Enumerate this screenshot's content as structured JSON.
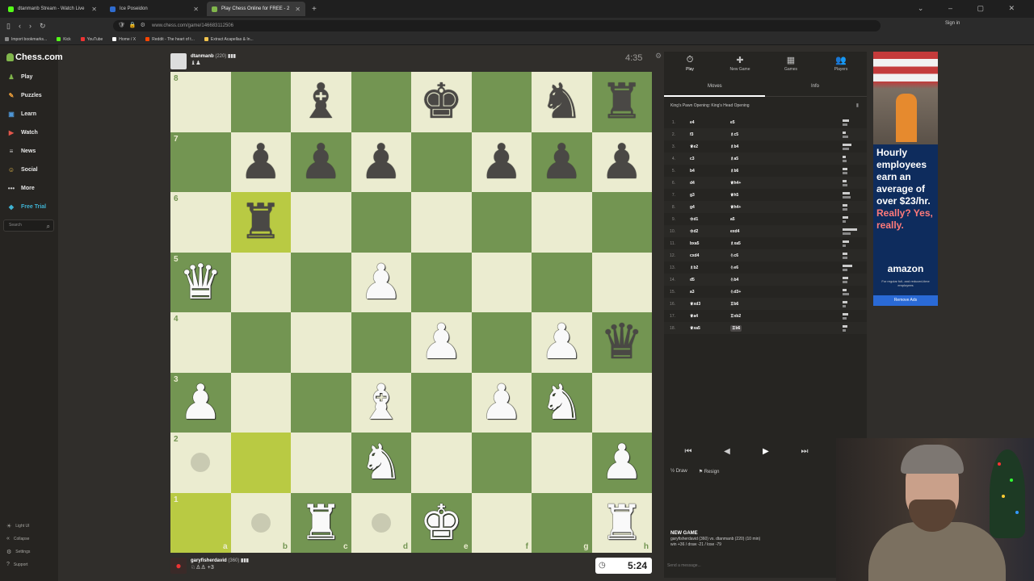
{
  "browser": {
    "tabs": [
      {
        "label": "dtanmanb Stream - Watch Live",
        "active": false
      },
      {
        "label": "Ice Poseidon",
        "active": false
      },
      {
        "label": "Play Chess Online for FREE - 2",
        "active": true
      }
    ],
    "url": "www.chess.com/game/146683112506",
    "sign_in": "Sign in",
    "bookmarks": [
      "Import bookmarks...",
      "Kick",
      "YouTube",
      "Home / X",
      "Reddit - The heart of t...",
      "Extract Acapellas & In..."
    ]
  },
  "sidebar": {
    "logo": "Chess.com",
    "items": [
      {
        "label": "Play",
        "icon": "♟",
        "color": "#81b64c"
      },
      {
        "label": "Puzzles",
        "icon": "✎",
        "color": "#f0a13a"
      },
      {
        "label": "Learn",
        "icon": "▣",
        "color": "#4e96d6"
      },
      {
        "label": "Watch",
        "icon": "▶",
        "color": "#e3564b"
      },
      {
        "label": "News",
        "icon": "≡",
        "color": "#c8c8c8"
      },
      {
        "label": "Social",
        "icon": "☺",
        "color": "#f1c34d"
      },
      {
        "label": "More",
        "icon": "•••",
        "color": "#c8c8c8"
      },
      {
        "label": "Free Trial",
        "icon": "◆",
        "color": "#3fb3d3"
      }
    ],
    "search_placeholder": "Search",
    "bottom": [
      {
        "label": "Light UI",
        "icon": "☀"
      },
      {
        "label": "Collapse",
        "icon": "«"
      },
      {
        "label": "Settings",
        "icon": "⚙"
      },
      {
        "label": "Support",
        "icon": "?"
      }
    ]
  },
  "top_player": {
    "name": "dtanmanb",
    "rating": "(220)",
    "captured": "♝♟",
    "clock": "4:35"
  },
  "bottom_player": {
    "name": "garyfisherdavid",
    "rating": "(360)",
    "captured": "♘♙♙ +3",
    "clock": "5:24"
  },
  "board": {
    "files": [
      "a",
      "b",
      "c",
      "d",
      "e",
      "f",
      "g",
      "h"
    ],
    "ranks": [
      "8",
      "7",
      "6",
      "5",
      "4",
      "3",
      "2",
      "1"
    ],
    "highlights": [
      "b6",
      "b2",
      "a1"
    ],
    "hints": [
      "a2",
      "b1",
      "d1"
    ],
    "pieces": [
      {
        "sq": "c8",
        "p": "b"
      },
      {
        "sq": "e8",
        "p": "k"
      },
      {
        "sq": "g8",
        "p": "n"
      },
      {
        "sq": "h8",
        "p": "r"
      },
      {
        "sq": "b7",
        "p": "p"
      },
      {
        "sq": "c7",
        "p": "p"
      },
      {
        "sq": "d7",
        "p": "p"
      },
      {
        "sq": "f7",
        "p": "p"
      },
      {
        "sq": "g7",
        "p": "p"
      },
      {
        "sq": "h7",
        "p": "p"
      },
      {
        "sq": "b6",
        "p": "r"
      },
      {
        "sq": "a5",
        "p": "Q"
      },
      {
        "sq": "d5",
        "p": "P"
      },
      {
        "sq": "e4",
        "p": "P"
      },
      {
        "sq": "g4",
        "p": "P"
      },
      {
        "sq": "h4",
        "p": "q"
      },
      {
        "sq": "a3",
        "p": "P"
      },
      {
        "sq": "d3",
        "p": "B"
      },
      {
        "sq": "f3",
        "p": "P"
      },
      {
        "sq": "g3",
        "p": "N"
      },
      {
        "sq": "d2",
        "p": "N"
      },
      {
        "sq": "h2",
        "p": "P"
      },
      {
        "sq": "c1",
        "p": "R"
      },
      {
        "sq": "e1",
        "p": "K"
      },
      {
        "sq": "h1",
        "p": "R"
      }
    ]
  },
  "panel": {
    "tabs": [
      {
        "label": "Play",
        "icon": "⏱"
      },
      {
        "label": "New Game",
        "icon": "✚"
      },
      {
        "label": "Games",
        "icon": "▦"
      },
      {
        "label": "Players",
        "icon": "👥"
      }
    ],
    "subtabs": [
      "Moves",
      "Info"
    ],
    "opening": "King's Pawn Opening: King's Head Opening",
    "moves": [
      {
        "n": "1.",
        "w": "e4",
        "b": "e5",
        "tw": 0.4,
        "tb": 0.3
      },
      {
        "n": "2.",
        "w": "f3",
        "b": "♗c5",
        "tw": 0.2,
        "tb": 0.35
      },
      {
        "n": "3.",
        "w": "♕e2",
        "b": "♗b4",
        "tw": 0.55,
        "tb": 0.4
      },
      {
        "n": "4.",
        "w": "c3",
        "b": "♗a5",
        "tw": 0.2,
        "tb": 0.25
      },
      {
        "n": "5.",
        "w": "b4",
        "b": "♗b6",
        "tw": 0.3,
        "tb": 0.3
      },
      {
        "n": "6.",
        "w": "d4",
        "b": "♕h4+",
        "tw": 0.25,
        "tb": 0.3
      },
      {
        "n": "7.",
        "w": "g3",
        "b": "♕h5",
        "tw": 0.45,
        "tb": 0.5
      },
      {
        "n": "8.",
        "w": "g4",
        "b": "♕h4+",
        "tw": 0.3,
        "tb": 0.3
      },
      {
        "n": "9.",
        "w": "♔d1",
        "b": "a5",
        "tw": 0.35,
        "tb": 0.2
      },
      {
        "n": "10.",
        "w": "♔d2",
        "b": "exd4",
        "tw": 0.9,
        "tb": 0.5
      },
      {
        "n": "11.",
        "w": "bxa5",
        "b": "♗xa5",
        "tw": 0.4,
        "tb": 0.2
      },
      {
        "n": "12.",
        "w": "cxd4",
        "b": "♘c6",
        "tw": 0.3,
        "tb": 0.3
      },
      {
        "n": "13.",
        "w": "♗b2",
        "b": "♘e6",
        "tw": 0.6,
        "tb": 0.3
      },
      {
        "n": "14.",
        "w": "d5",
        "b": "♘b4",
        "tw": 0.35,
        "tb": 0.3
      },
      {
        "n": "15.",
        "w": "a3",
        "b": "♘d3+",
        "tw": 0.25,
        "tb": 0.4
      },
      {
        "n": "16.",
        "w": "♕xd3",
        "b": "♖b6",
        "tw": 0.3,
        "tb": 0.2
      },
      {
        "n": "17.",
        "w": "♕a4",
        "b": "♖xb2",
        "tw": 0.35,
        "tb": 0.25
      },
      {
        "n": "18.",
        "w": "♕xa5",
        "b": "♖b6",
        "tw": 0.3,
        "tb": 0.2
      }
    ],
    "controls": [
      "⏮",
      "◀",
      "▶",
      "⏭"
    ],
    "draw": "Draw",
    "resign": "Resign",
    "new_game_title": "NEW GAME",
    "new_game_line1": "garyfisherdavid (360) vs. dtanmanb (220) (10 min)",
    "new_game_line2": "win +36 / draw -21 / lose -79",
    "chat_placeholder": "Send a message..."
  },
  "ad": {
    "headline": "Hourly employees earn an average of over $23/hr.",
    "tagline": "Really? Yes, really.",
    "brand": "amazon",
    "small": "For regular full- and reduced-time employees",
    "button": "Remove Ads"
  }
}
